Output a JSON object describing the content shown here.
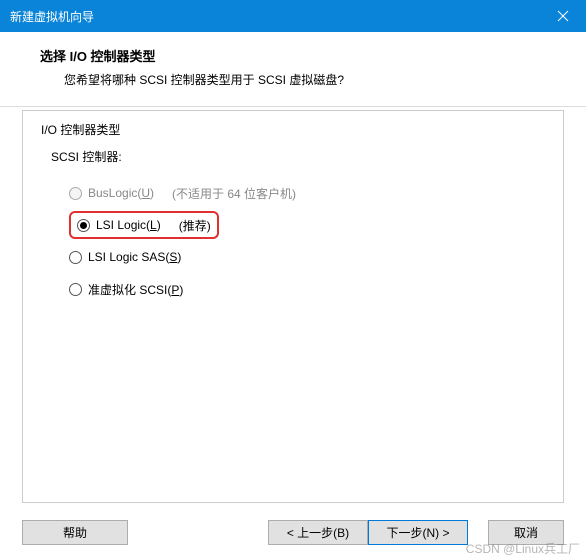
{
  "window": {
    "title": "新建虚拟机向导"
  },
  "header": {
    "title": "选择 I/O 控制器类型",
    "desc": "您希望将哪种 SCSI 控制器类型用于 SCSI 虚拟磁盘?"
  },
  "group": {
    "label": "I/O 控制器类型",
    "sub_label": "SCSI 控制器:"
  },
  "options": {
    "buslogic": {
      "label": "BusLogic(",
      "mnemonic": "U",
      "tail": ")",
      "hint": "(不适用于 64 位客户机)"
    },
    "lsi": {
      "label": "LSI Logic(",
      "mnemonic": "L",
      "tail": ")",
      "hint": "(推荐)"
    },
    "lsisas": {
      "label": "LSI Logic SAS(",
      "mnemonic": "S",
      "tail": ")"
    },
    "pvscsi": {
      "label": "准虚拟化 SCSI(",
      "mnemonic": "P",
      "tail": ")"
    }
  },
  "buttons": {
    "help": "帮助",
    "back": "< 上一步(B)",
    "next": "下一步(N) >",
    "cancel": "取消"
  },
  "watermark": "CSDN @Linux兵工厂"
}
